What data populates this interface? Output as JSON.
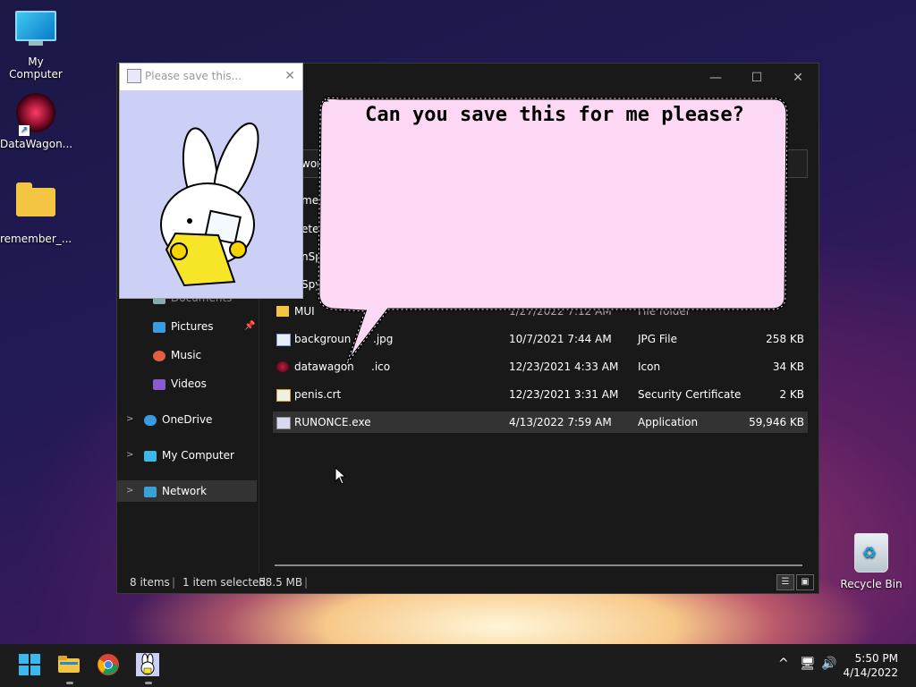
{
  "desktop": {
    "icons": [
      {
        "label": "My Computer"
      },
      {
        "label": "DataWagon..."
      },
      {
        "label": "remember_..."
      },
      {
        "label": "Recycle Bin"
      }
    ]
  },
  "popup": {
    "title": "Please save this...",
    "close": "✕"
  },
  "bubble": {
    "text": "Can you save this for me please?"
  },
  "explorer": {
    "partial_labels": [
      "wor",
      "me",
      "ete",
      "nSp",
      "Spy"
    ],
    "nav": {
      "documents": "Documents",
      "pictures": "Pictures",
      "music": "Music",
      "videos": "Videos",
      "onedrive": "OneDrive",
      "mycomputer": "My Computer",
      "network": "Network"
    },
    "files": [
      {
        "name": "MUI",
        "date": "1/27/2022 7:12 AM",
        "type": "File folder",
        "size": ""
      },
      {
        "name": "backgroun",
        "name_tail": ".jpg",
        "date": "10/7/2021 7:44 AM",
        "type": "JPG File",
        "size": "258 KB"
      },
      {
        "name": "datawagon",
        "name_tail": ".ico",
        "date": "12/23/2021 4:33 AM",
        "type": "Icon",
        "size": "34 KB"
      },
      {
        "name": "penis.crt",
        "date": "12/23/2021 3:31 AM",
        "type": "Security Certificate",
        "size": "2 KB"
      },
      {
        "name": "RUNONCE.exe",
        "date": "4/13/2022 7:59 AM",
        "type": "Application",
        "size": "59,946 KB"
      }
    ],
    "status": {
      "items": "8 items",
      "selected": "1 item selected",
      "size": "58.5 MB"
    },
    "controls": {
      "minimize": "—",
      "maximize": "☐",
      "close": "✕"
    }
  },
  "taskbar": {
    "time": "5:50 PM",
    "date": "4/14/2022",
    "tray_chevron": "^"
  },
  "colors": {
    "explorer_bg": "#191919",
    "popup_bg": "#ccd0f6",
    "bubble_fill": "#fdd8f4",
    "folder": "#f4c542",
    "taskbar": "#1c1c1c"
  }
}
